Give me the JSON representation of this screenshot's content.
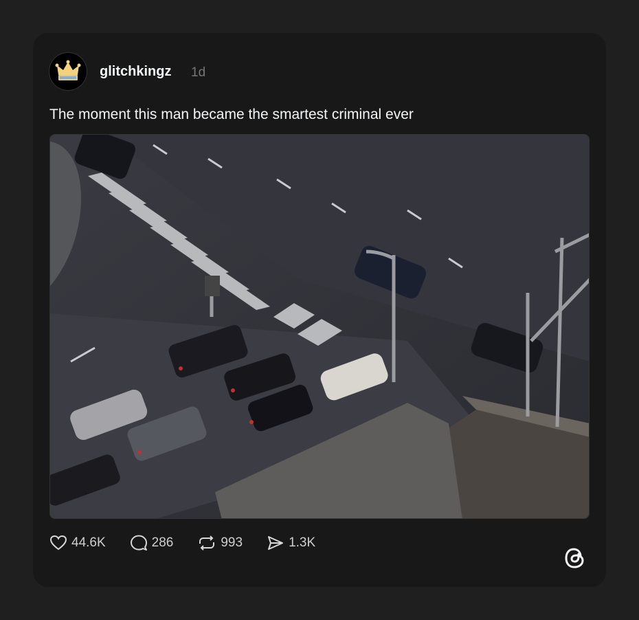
{
  "post": {
    "username": "glitchkingz",
    "time": "1d",
    "caption": "The moment this man became the smartest criminal ever",
    "avatar_icon": "crown-icon",
    "media_description_icon": "video-thumbnail"
  },
  "actions": {
    "likes": "44.6K",
    "comments": "286",
    "reposts": "993",
    "shares": "1.3K"
  },
  "brand": {
    "icon": "threads-logo-icon"
  },
  "colors": {
    "background": "#1f1f1f",
    "card": "#181818",
    "text": "#f3f5f7",
    "muted": "#777777"
  }
}
